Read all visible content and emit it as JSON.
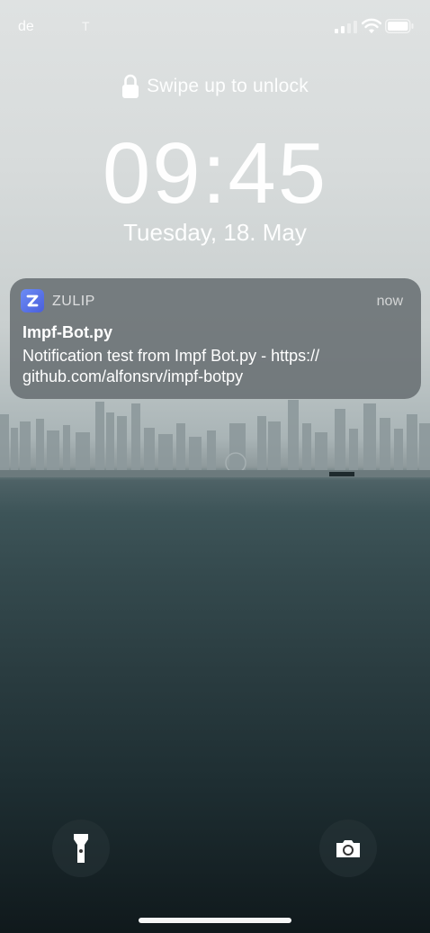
{
  "status_bar": {
    "carrier": "de",
    "carrier_secondary": "T",
    "signal_icon": "cellular-signal-icon",
    "wifi_icon": "wifi-icon",
    "battery_icon": "battery-icon"
  },
  "lock_screen": {
    "lock_icon": "lock-icon",
    "swipe_hint": "Swipe up to unlock",
    "time": "09:45",
    "date": "Tuesday, 18. May"
  },
  "notification": {
    "app_icon": "zulip-app-icon",
    "app_name": "ZULIP",
    "time": "now",
    "title": "Impf-Bot.py",
    "body_line_1": "Notification test from Impf Bot.py - https://",
    "body_line_2": "github.com/alfonsrv/impf-botpy"
  },
  "quick_actions": {
    "flashlight_icon": "flashlight-icon",
    "camera_icon": "camera-icon"
  },
  "colors": {
    "notification_bg": "#6e7578",
    "zulip_icon": "#5b73e8",
    "text": "#ffffff"
  }
}
